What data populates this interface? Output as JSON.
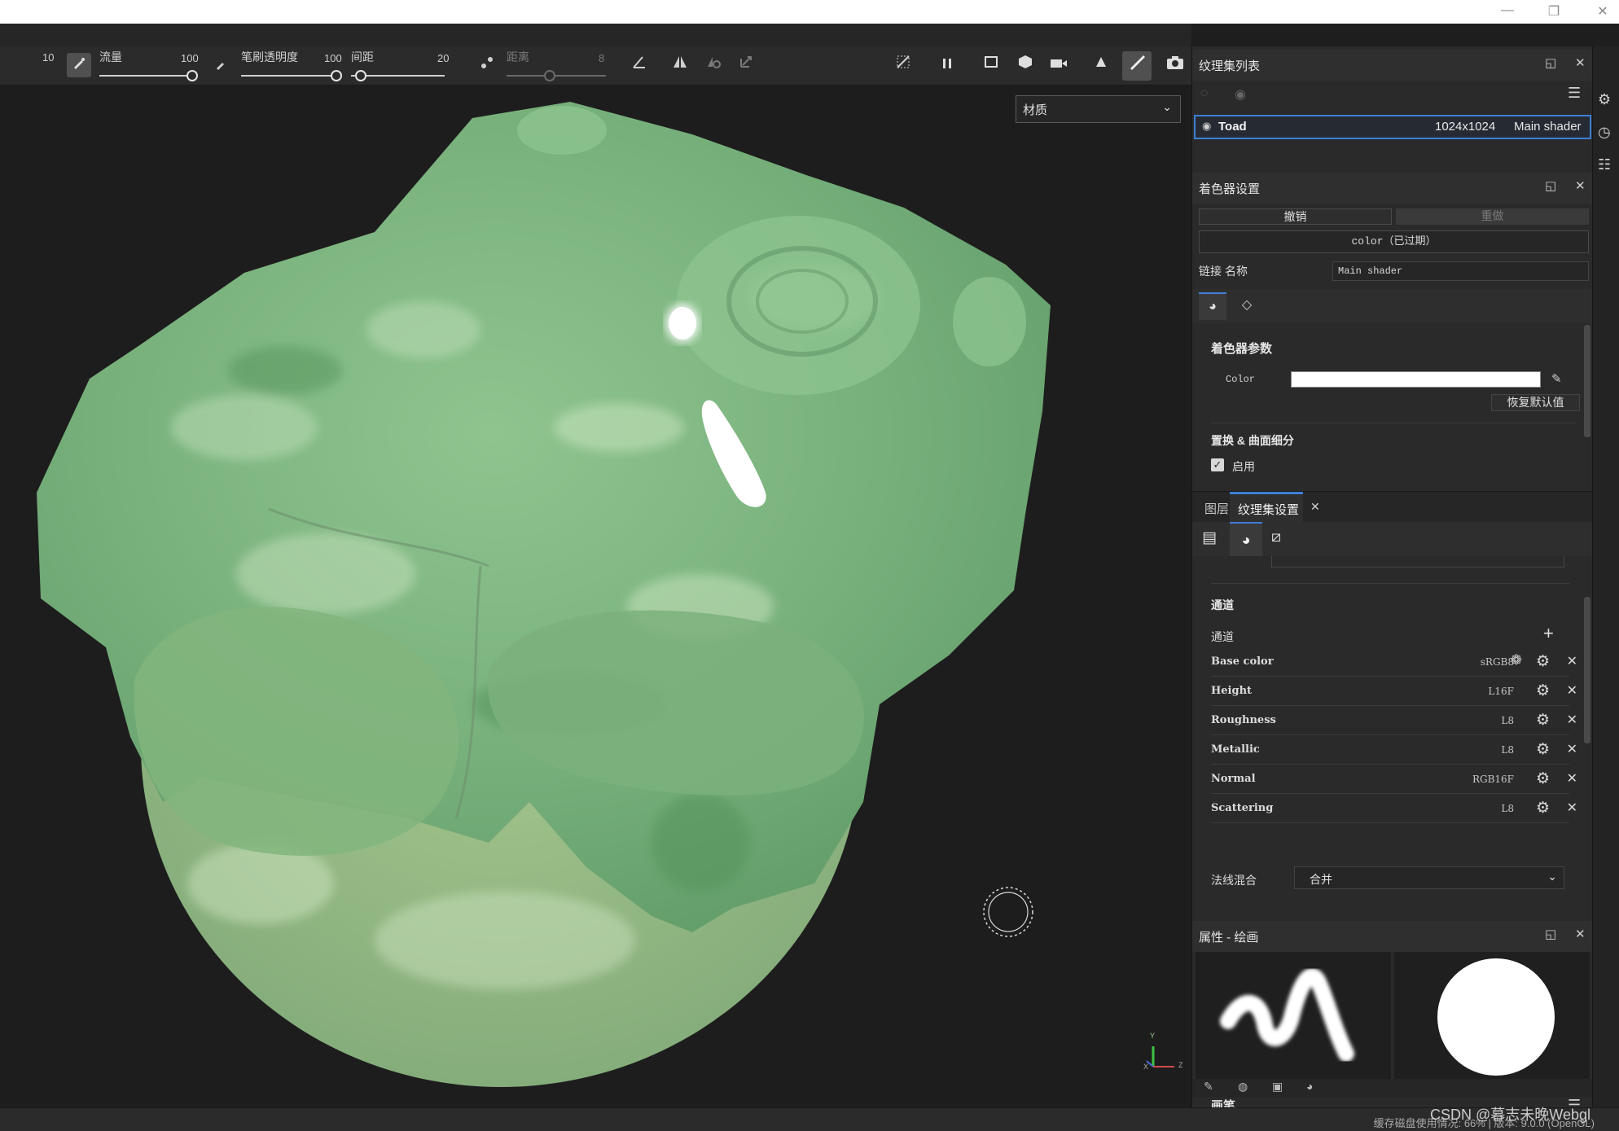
{
  "window": {
    "minimize": "—",
    "restore": "❐",
    "close": "✕"
  },
  "toolbar": {
    "size_value": "10",
    "flow_label": "流量",
    "flow_value": "100",
    "opacity_label": "笔刷透明度",
    "opacity_value": "100",
    "spacing_label": "间距",
    "spacing_value": "20",
    "distance_label": "距离",
    "distance_value": "8"
  },
  "viewport": {
    "material_select": "材质",
    "gizmo_y": "Y",
    "gizmo_x": "X",
    "gizmo_z": "Z"
  },
  "texture_set_list": {
    "title": "纹理集列表",
    "item": {
      "name": "Toad",
      "resolution": "1024x1024",
      "shader": "Main shader"
    }
  },
  "shader_settings": {
    "title": "着色器设置",
    "undo": "撤销",
    "redo": "重做",
    "shader_type": "color（已过期）",
    "link_label": "链接",
    "name_label": "名称",
    "name_value": "Main shader",
    "params_title": "着色器参数",
    "color_label": "Color",
    "reset_default": "恢复默认值",
    "displacement_title": "置换 & 曲面细分",
    "enable_label": "启用",
    "enable_checked": true
  },
  "tabs": {
    "layers": "图层",
    "texture_set_settings": "纹理集设置"
  },
  "texture_set_settings": {
    "channels_title": "通道",
    "channels_label": "通道",
    "channels": [
      {
        "name": "Base color",
        "format": "sRGB8"
      },
      {
        "name": "Height",
        "format": "L16F"
      },
      {
        "name": "Roughness",
        "format": "L8"
      },
      {
        "name": "Metallic",
        "format": "L8"
      },
      {
        "name": "Normal",
        "format": "RGB16F"
      },
      {
        "name": "Scattering",
        "format": "L8"
      }
    ],
    "normal_blend_label": "法线混合",
    "normal_blend_value": "合并"
  },
  "properties": {
    "title": "属性 - 绘画",
    "brush_label": "画笔"
  },
  "status": {
    "text": "缓存磁盘使用情况: 66% | 版本: 9.0.0 (OpenGL)",
    "watermark": "CSDN @暮志未晚Webgl"
  },
  "colors": {
    "accent_blue": "#3d7fd6",
    "toad_green": "#7fb883",
    "panel_bg": "#2a2a2a"
  },
  "icons": [
    "brush-icon",
    "symmetry-icon",
    "pause-icon",
    "camera-icon",
    "eye-icon",
    "gear-icon",
    "close-icon",
    "add-icon",
    "pin-icon",
    "menu-icon"
  ]
}
